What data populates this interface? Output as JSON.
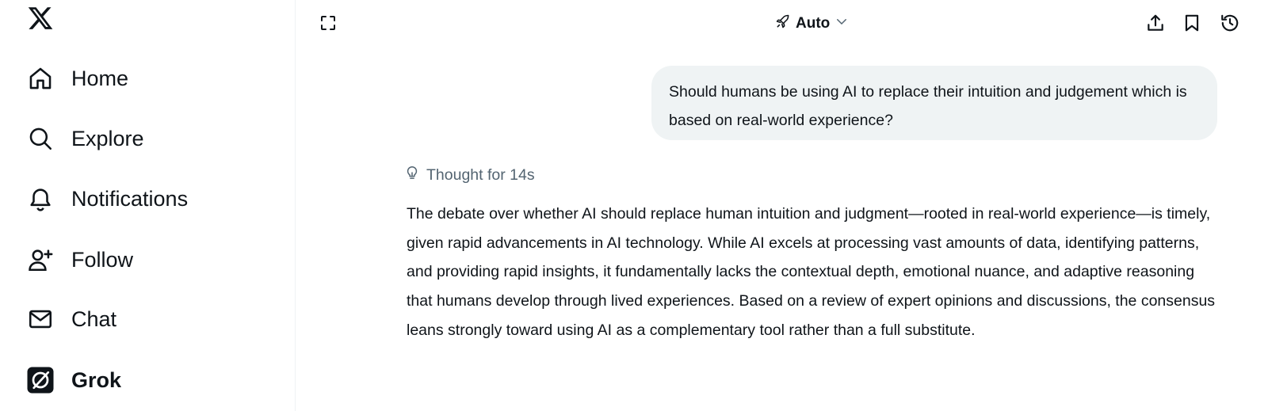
{
  "sidebar": {
    "logo": "x-logo-icon",
    "items": [
      {
        "label": "Home",
        "icon": "home-icon"
      },
      {
        "label": "Explore",
        "icon": "search-icon"
      },
      {
        "label": "Notifications",
        "icon": "bell-icon"
      },
      {
        "label": "Follow",
        "icon": "add-user-icon"
      },
      {
        "label": "Chat",
        "icon": "mail-icon"
      },
      {
        "label": "Grok",
        "icon": "grok-icon",
        "active": true
      }
    ]
  },
  "topbar": {
    "model_label": "Auto",
    "icons": [
      "expand-icon",
      "rocket-icon",
      "chevron-down-icon",
      "share-icon",
      "bookmark-icon",
      "history-icon"
    ]
  },
  "conversation": {
    "user_message": "Should humans be using AI to replace their intuition and judgement which is based on real-world experience?",
    "thought_label": "Thought for 14s",
    "answer": "The debate over whether AI should replace human intuition and judgment—rooted in real-world experience—is timely, given rapid advancements in AI technology. While AI excels at processing vast amounts of data, identifying patterns, and providing rapid insights, it fundamentally lacks the contextual depth, emotional nuance, and adaptive reasoning that humans develop through lived experiences. Based on a review of expert opinions and discussions, the consensus leans strongly toward using AI as a complementary tool rather than a full substitute."
  },
  "colors": {
    "text": "#0f1419",
    "muted": "#536471",
    "bubble": "#eff3f4"
  }
}
